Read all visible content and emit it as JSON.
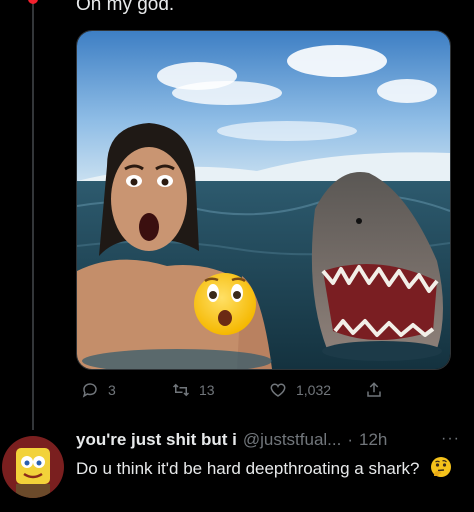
{
  "tweet": {
    "text": "Oh my god.",
    "image_alt_icon": "photo-man-and-shark",
    "actions": {
      "replies": "3",
      "retweets": "13",
      "likes": "1,032"
    }
  },
  "reply": {
    "display_name": "you're just shit but i",
    "handle": "@juststfual...",
    "separator": "·",
    "time": "12h",
    "more": "···",
    "text": "Do u think it'd be hard deepthroating a shark?"
  },
  "colors": {
    "background": "#000000",
    "text": "#e7e9ea",
    "muted": "#71767b",
    "thread_line": "#333639",
    "accent_dot": "#f4212e"
  },
  "icons": {
    "reply": "comment-icon",
    "retweet": "retweet-icon",
    "like": "heart-icon",
    "share": "share-icon",
    "emoji_surprised": "astonished-face-emoji",
    "emoji_thinking": "thinking-face-emoji"
  }
}
